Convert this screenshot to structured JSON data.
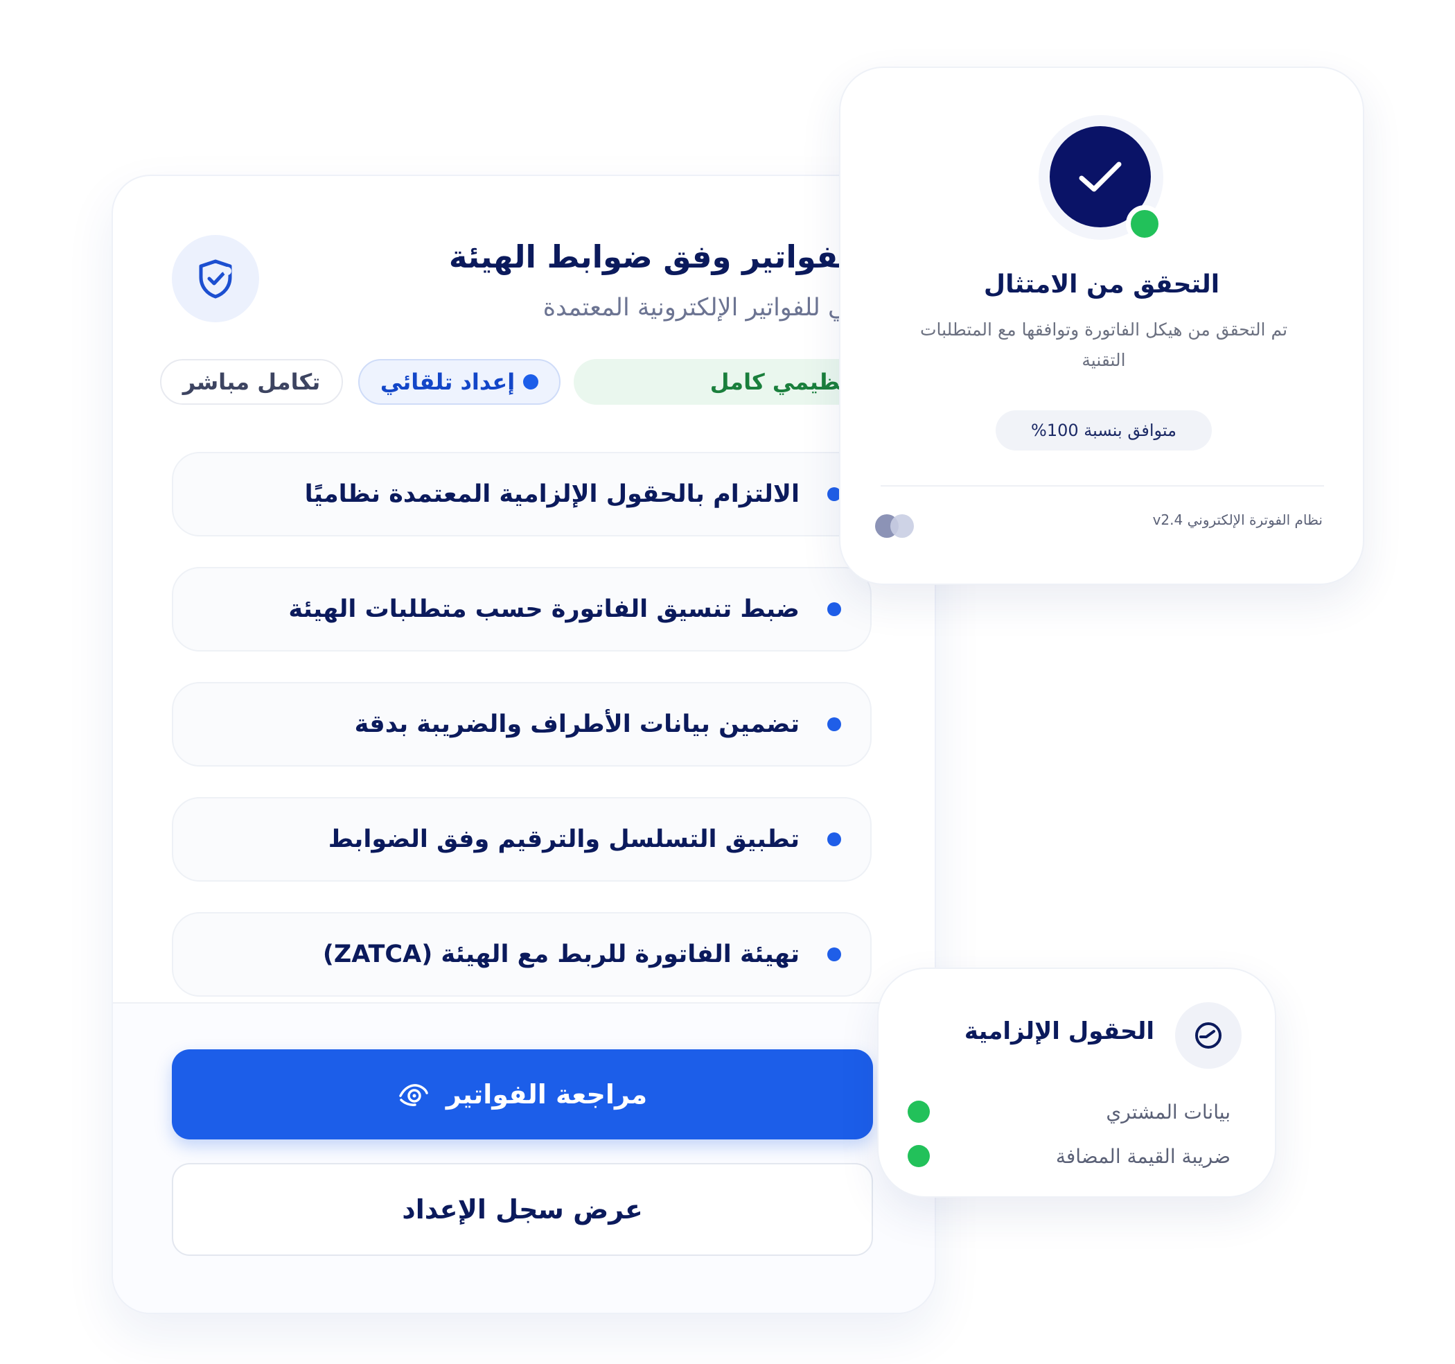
{
  "main_card": {
    "title": "تهيئة الفواتير وفق ضوابط الهيئة",
    "subtitle": "إعداد تلقائي للفواتير الإلكترونية المعتمدة",
    "chips": {
      "compliance": "توافق تنظيمي كامل",
      "auto_setup": "إعداد تلقائي",
      "direct_integration": "تكامل مباشر"
    },
    "items": [
      "الالتزام بالحقول الإلزامية المعتمدة نظاميًا",
      "ضبط تنسيق الفاتورة حسب متطلبات الهيئة",
      "تضمين بيانات الأطراف والضريبة بدقة",
      "تطبيق التسلسل والترقيم وفق الضوابط",
      "تهيئة الفاتورة للربط مع الهيئة (ZATCA)"
    ],
    "primary_button": "مراجعة الفواتير",
    "secondary_button": "عرض سجل الإعداد"
  },
  "compliance_card": {
    "title": "التحقق من الامتثال",
    "description": "تم التحقق من هيكل الفاتورة وتوافقها مع المتطلبات التقنية",
    "badge": "متوافق بنسبة 100%",
    "version": "نظام الفوترة الإلكتروني v2.4"
  },
  "fields_card": {
    "title": "الحقول الإلزامية",
    "fields": [
      "بيانات المشتري",
      "ضريبة القيمة المضافة"
    ]
  },
  "colors": {
    "primary": "#1c5ee9",
    "navy": "#0b1a5c",
    "success": "#22c15a",
    "success_text": "#1a7f3c"
  },
  "icons": {
    "shield": "shield-check-icon",
    "check": "check-icon",
    "eye": "eye-icon",
    "gauge": "gauge-icon"
  }
}
